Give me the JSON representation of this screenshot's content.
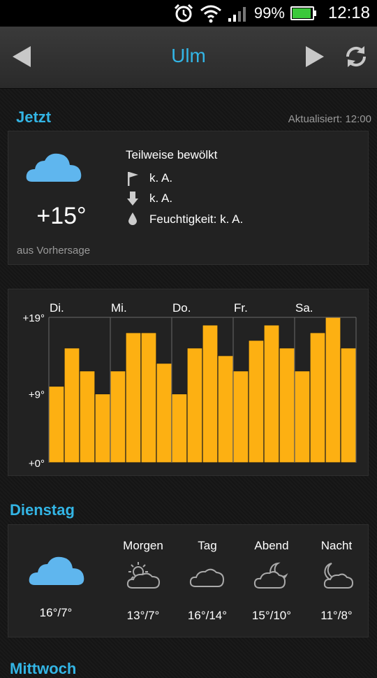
{
  "status_bar": {
    "battery": "99%",
    "time": "12:18",
    "battery_level": 0.99
  },
  "header": {
    "city": "Ulm"
  },
  "now": {
    "title": "Jetzt",
    "updated": "Aktualisiert: 12:00",
    "temperature": "+15°",
    "source": "aus Vorhersage",
    "condition": "Teilweise bewölkt",
    "wind": "k. A.",
    "pressure": "k. A.",
    "humidity": "Feuchtigkeit: k. A."
  },
  "chart_data": {
    "type": "bar",
    "days": [
      "Di.",
      "Mi.",
      "Do.",
      "Fr.",
      "Sa."
    ],
    "y_tick_labels": [
      "+19°",
      "+9°",
      "+0°"
    ],
    "ylim": [
      0,
      19
    ],
    "values": [
      10,
      15,
      12,
      9,
      12,
      17,
      17,
      13,
      9,
      15,
      18,
      14,
      12,
      16,
      18,
      15,
      12,
      17,
      19,
      15
    ],
    "bars_per_day": 4,
    "bar_color": "#FDB012"
  },
  "forecast": {
    "title": "Dienstag",
    "day_temp": "16°/7°",
    "periods": [
      {
        "label": "Morgen",
        "temp": "13°/7°"
      },
      {
        "label": "Tag",
        "temp": "16°/14°"
      },
      {
        "label": "Abend",
        "temp": "15°/10°"
      },
      {
        "label": "Nacht",
        "temp": "11°/8°"
      }
    ]
  },
  "next_section": {
    "title": "Mittwoch"
  },
  "colors": {
    "accent": "#33B5E5",
    "bar": "#FDB012",
    "cloud": "#5FB6EE"
  }
}
